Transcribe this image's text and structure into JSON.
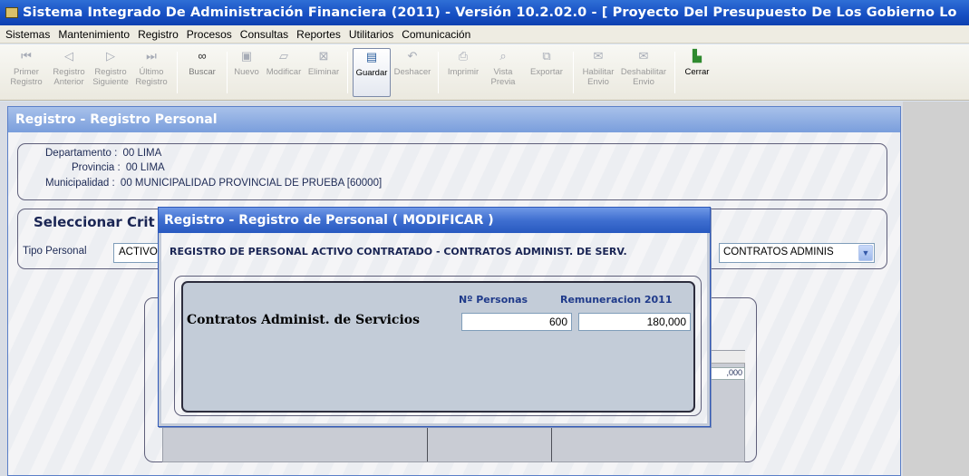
{
  "window": {
    "title": "Sistema Integrado De Administración Financiera (2011) - Versión 10.2.02.0 - [ Proyecto Del Presupuesto De Los Gobierno Lo"
  },
  "menu": [
    "Sistemas",
    "Mantenimiento",
    "Registro",
    "Procesos",
    "Consultas",
    "Reportes",
    "Utilitarios",
    "Comunicación"
  ],
  "toolbar": {
    "primer": [
      "Primer",
      "Registro"
    ],
    "anterior": [
      "Registro",
      "Anterior"
    ],
    "siguiente": [
      "Registro",
      "Siguiente"
    ],
    "ultimo": [
      "Último",
      "Registro"
    ],
    "buscar": [
      "Buscar"
    ],
    "nuevo": [
      "Nuevo"
    ],
    "modificar": [
      "Modificar"
    ],
    "eliminar": [
      "Eliminar"
    ],
    "guardar": [
      "Guardar"
    ],
    "deshacer": [
      "Deshacer"
    ],
    "imprimir": [
      "Imprimir"
    ],
    "vista": [
      "Vista",
      "Previa"
    ],
    "exportar": [
      "Exportar"
    ],
    "habilitar": [
      "Habilitar",
      "Envio"
    ],
    "deshabilitar": [
      "Deshabilitar",
      "Envio"
    ],
    "cerrar": [
      "Cerrar"
    ]
  },
  "main": {
    "title": "Registro - Registro Personal",
    "departamento_label": "Departamento :",
    "departamento_value": "00  LIMA",
    "provincia_label": "Provincia :",
    "provincia_value": "00  LIMA",
    "municipalidad_label": "Municipalidad :",
    "municipalidad_value": "00  MUNICIPALIDAD PROVINCIAL DE PRUEBA [60000]",
    "group_title": "Seleccionar Crit",
    "tipo_personal_label": "Tipo Personal",
    "tipo_personal_value": "ACTIVO",
    "combo_value": "CONTRATOS ADMINIS",
    "grid_value": ",000"
  },
  "dialog": {
    "title": "Registro - Registro de Personal ( MODIFICAR )",
    "header": "REGISTRO DE PERSONAL ACTIVO CONTRATADO - CONTRATOS ADMINIST. DE SERV.",
    "col_personas": "Nº Personas",
    "col_remuneracion": "Remuneracion 2011",
    "row_label": "Contratos Administ. de Servicios",
    "personas_value": "600",
    "remuneracion_value": "180,000"
  }
}
